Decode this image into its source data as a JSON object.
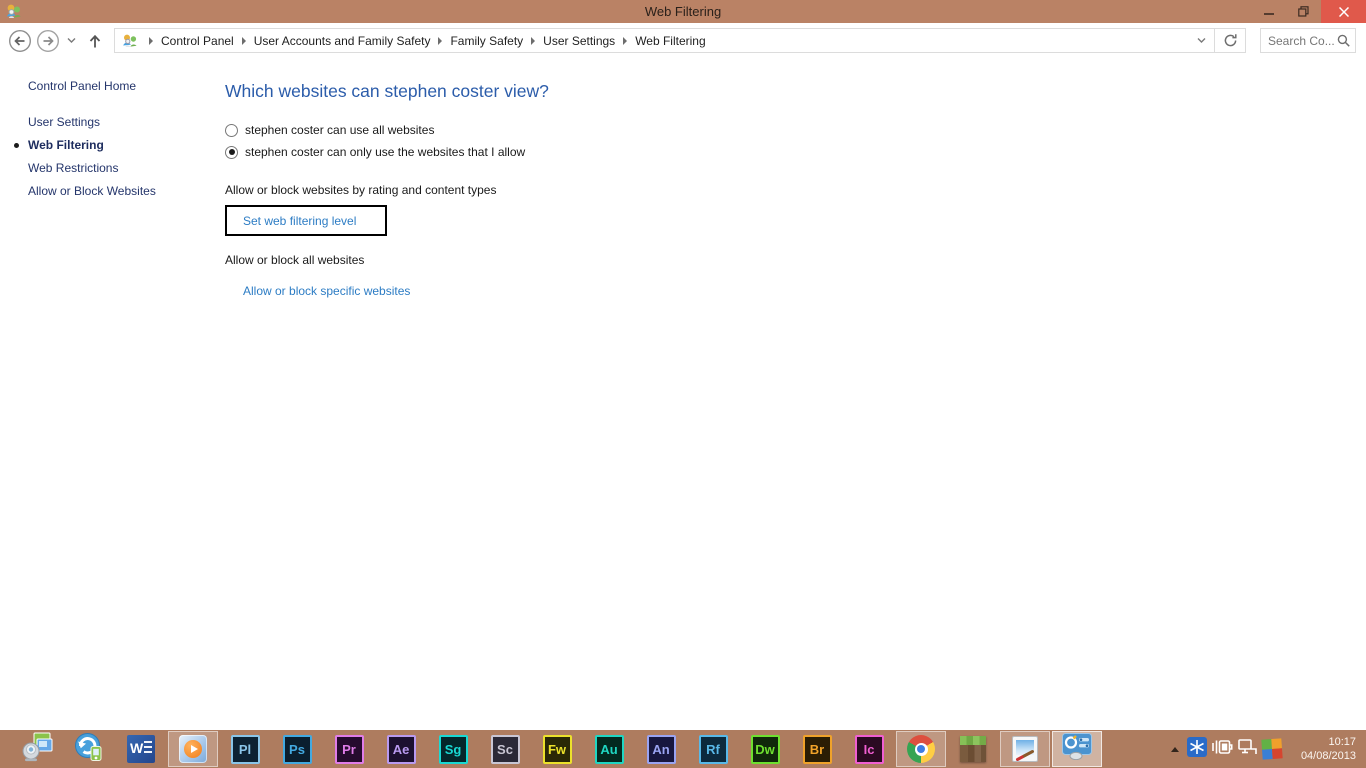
{
  "colors": {
    "titlebar": "#ba8265",
    "taskbar": "#ae7c5f",
    "close_button": "#e0594b",
    "heading_blue": "#2b5caa",
    "link_blue": "#2c7cc4",
    "sidebar_navy": "#24356b"
  },
  "window": {
    "title": "Web Filtering"
  },
  "navbar": {
    "breadcrumb": [
      "Control Panel",
      "User Accounts and Family Safety",
      "Family Safety",
      "User Settings",
      "Web Filtering"
    ],
    "search_placeholder": "Search Co..."
  },
  "sidebar": {
    "items": [
      {
        "label": "Control Panel Home",
        "home": true
      },
      {
        "label": "User Settings"
      },
      {
        "label": "Web Filtering",
        "active": true
      },
      {
        "label": "Web Restrictions"
      },
      {
        "label": "Allow or Block Websites"
      }
    ]
  },
  "main": {
    "heading": "Which websites can stephen coster view?",
    "radios": [
      {
        "label": "stephen coster can use all websites",
        "selected": false
      },
      {
        "label": "stephen coster can only use the websites that I allow",
        "selected": true
      }
    ],
    "rating_section_label": "Allow or block websites by rating and content types",
    "set_filtering_button": "Set web filtering level",
    "all_sites_section_label": "Allow or block all websites",
    "specific_sites_link": "Allow or block specific websites"
  },
  "taskbar": {
    "apps": [
      {
        "kind": "photo",
        "name": "webcam-photos"
      },
      {
        "kind": "sync",
        "name": "media-sync"
      },
      {
        "kind": "word",
        "name": "word",
        "letter": "W"
      },
      {
        "kind": "wmp",
        "name": "windows-media-player",
        "running": true
      },
      {
        "kind": "adobe",
        "name": "adobe-prelude",
        "label": "Pl",
        "fg": "#8ac5e8",
        "bg": "#0c2233"
      },
      {
        "kind": "adobe",
        "name": "adobe-photoshop",
        "label": "Ps",
        "fg": "#43a9e0",
        "bg": "#0a1e2e"
      },
      {
        "kind": "adobe",
        "name": "adobe-premiere",
        "label": "Pr",
        "fg": "#e07de8",
        "bg": "#260b2e"
      },
      {
        "kind": "adobe",
        "name": "adobe-after-effects",
        "label": "Ae",
        "fg": "#b99af0",
        "bg": "#1c1030"
      },
      {
        "kind": "adobe",
        "name": "adobe-speedgrade",
        "label": "Sg",
        "fg": "#19d9d3",
        "bg": "#04272b"
      },
      {
        "kind": "adobe",
        "name": "adobe-scout",
        "label": "Sc",
        "fg": "#c9c6d4",
        "bg": "#2b2937"
      },
      {
        "kind": "adobe",
        "name": "adobe-fireworks",
        "label": "Fw",
        "fg": "#ece12b",
        "bg": "#2a2806"
      },
      {
        "kind": "adobe",
        "name": "adobe-audition",
        "label": "Au",
        "fg": "#1fd6c2",
        "bg": "#03291f"
      },
      {
        "kind": "adobe",
        "name": "adobe-animate",
        "label": "An",
        "fg": "#9aa4f2",
        "bg": "#17173f"
      },
      {
        "kind": "adobe",
        "name": "adobe-reflow",
        "label": "Rf",
        "fg": "#59b9e8",
        "bg": "#0c2a3d"
      },
      {
        "kind": "adobe",
        "name": "adobe-dreamweaver",
        "label": "Dw",
        "fg": "#6ee02f",
        "bg": "#10280a"
      },
      {
        "kind": "adobe",
        "name": "adobe-bridge",
        "label": "Br",
        "fg": "#f0a22a",
        "bg": "#2b1d04"
      },
      {
        "kind": "adobe",
        "name": "adobe-incopy",
        "label": "Ic",
        "fg": "#f05fd2",
        "bg": "#2b0a22"
      },
      {
        "kind": "chrome",
        "name": "chrome",
        "running": true
      },
      {
        "kind": "minecraft",
        "name": "minecraft"
      },
      {
        "kind": "paint",
        "name": "paint",
        "running": true
      },
      {
        "kind": "cpanel",
        "name": "control-panel",
        "active": true
      }
    ],
    "tray": {
      "icons": [
        {
          "kind": "snowflake",
          "name": "deep-freeze"
        },
        {
          "kind": "power",
          "name": "power"
        },
        {
          "kind": "network",
          "name": "network"
        },
        {
          "kind": "avg",
          "name": "antivirus"
        }
      ],
      "time": "10:17",
      "date": "04/08/2013"
    }
  }
}
